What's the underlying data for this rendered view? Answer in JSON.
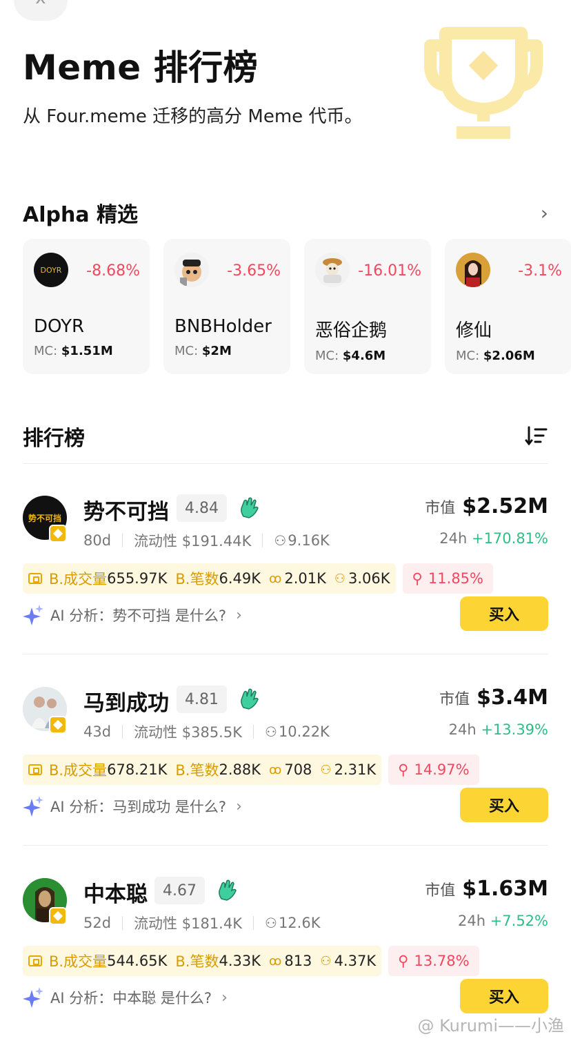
{
  "header": {
    "close_icon": "x",
    "title": "Meme 排行榜",
    "subtitle": "从 Four.meme 迁移的高分 Meme 代币。",
    "decoration_icon": "trophy-icon"
  },
  "alpha": {
    "title": "Alpha 精选",
    "cards": [
      {
        "avatar_text": "DOYR",
        "name": "DOYR",
        "change": "-8.68%",
        "mc_label": "MC: ",
        "mc_value": "$1.51M"
      },
      {
        "avatar_text": "",
        "name": "BNBHolder",
        "change": "-3.65%",
        "mc_label": "MC: ",
        "mc_value": "$2M"
      },
      {
        "avatar_text": "",
        "name": "恶俗企鹅",
        "change": "-16.01%",
        "mc_label": "MC: ",
        "mc_value": "$4.6M"
      },
      {
        "avatar_text": "",
        "name": "修仙",
        "change": "-3.1%",
        "mc_label": "MC: ",
        "mc_value": "$2.06M"
      }
    ]
  },
  "ranking": {
    "title": "排行榜",
    "tokens": [
      {
        "avatar_text": "势不可挡",
        "name": "势不可挡",
        "score": "4.84",
        "age": "80d",
        "liquidity": "流动性 $191.44K",
        "holders": "9.16K",
        "mcap_label": "市值",
        "mcap_value": "$2.52M",
        "change_label": "24h",
        "change": "+170.81%",
        "volume_label": "B.成交量",
        "volume": "655.97K",
        "trades_label": "B.笔数",
        "trades": "6.49K",
        "metric_a": "2.01K",
        "metric_b": "3.06K",
        "risk": "11.85%",
        "ai_text": "AI 分析：势不可挡 是什么?",
        "buy_label": "买入"
      },
      {
        "avatar_text": "",
        "name": "马到成功",
        "score": "4.81",
        "age": "43d",
        "liquidity": "流动性 $385.5K",
        "holders": "10.22K",
        "mcap_label": "市值",
        "mcap_value": "$3.4M",
        "change_label": "24h",
        "change": "+13.39%",
        "volume_label": "B.成交量",
        "volume": "678.21K",
        "trades_label": "B.笔数",
        "trades": "2.88K",
        "metric_a": "708",
        "metric_b": "2.31K",
        "risk": "14.97%",
        "ai_text": "AI 分析：马到成功 是什么?",
        "buy_label": "买入"
      },
      {
        "avatar_text": "",
        "name": "中本聪",
        "score": "4.67",
        "age": "52d",
        "liquidity": "流动性 $181.4K",
        "holders": "12.6K",
        "mcap_label": "市值",
        "mcap_value": "$1.63M",
        "change_label": "24h",
        "change": "+7.52%",
        "volume_label": "B.成交量",
        "volume": "544.65K",
        "trades_label": "B.笔数",
        "trades": "4.33K",
        "metric_a": "813",
        "metric_b": "4.37K",
        "risk": "13.78%",
        "ai_text": "AI 分析：中本聪 是什么?",
        "buy_label": "买入"
      }
    ]
  },
  "watermark": "@ Kurumi——小渔",
  "colors": {
    "accent_yellow": "#fcd535",
    "negative": "#f6465d",
    "positive": "#2ebd85"
  }
}
